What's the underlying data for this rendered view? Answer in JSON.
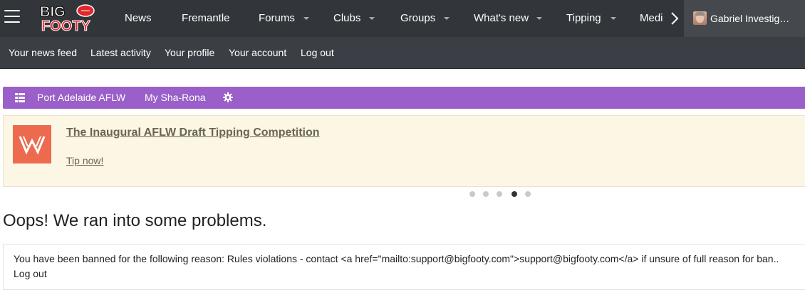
{
  "topnav": {
    "logo_text_1": "BIG",
    "logo_text_2": "FOOTY",
    "items": [
      {
        "label": "News"
      },
      {
        "label": "Fremantle"
      },
      {
        "label": "Forums"
      },
      {
        "label": "Clubs"
      },
      {
        "label": "Groups"
      },
      {
        "label": "What's new"
      },
      {
        "label": "Tipping"
      },
      {
        "label": "Medi"
      }
    ],
    "user_name": "Gabriel Investig…"
  },
  "subnav": {
    "items": [
      {
        "label": "Your news feed"
      },
      {
        "label": "Latest activity"
      },
      {
        "label": "Your profile"
      },
      {
        "label": "Your account"
      },
      {
        "label": "Log out"
      }
    ]
  },
  "breadcrumb": {
    "items": [
      {
        "label": "Port Adelaide AFLW"
      },
      {
        "label": "My Sha-Rona"
      }
    ]
  },
  "notice": {
    "title": "The Inaugural AFLW Draft Tipping Competition",
    "link": "Tip now!",
    "dots_total": 5,
    "dots_active": 4
  },
  "error": {
    "heading": "Oops! We ran into some problems.",
    "message": "You have been banned for the following reason: Rules violations - contact <a href=\"mailto:support@bigfooty.com\">support@bigfooty.com</a> if unsure of full reason for ban..",
    "logout": "Log out"
  },
  "colors": {
    "topbar": "#32353a",
    "subbar": "#3b3e44",
    "breadcrumb": "#9a5fc9",
    "notice_bg": "#fcf6e4",
    "notice_logo": "#ec6b4f"
  }
}
